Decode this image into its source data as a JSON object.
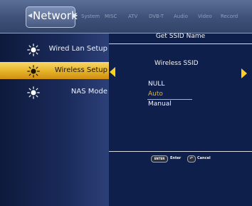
{
  "tabs": {
    "active": "Network",
    "items": [
      "System",
      "MISC",
      "ATV",
      "DVB-T",
      "Audio",
      "Video",
      "Record"
    ]
  },
  "sidebar": {
    "items": [
      {
        "label": "Wired Lan Setup",
        "icon": "sun-icon",
        "selected": false
      },
      {
        "label": "Wireless Setup",
        "icon": "sun-icon",
        "selected": true
      },
      {
        "label": "NAS Mode",
        "icon": "sun-icon",
        "selected": false
      }
    ]
  },
  "panel": {
    "title": "Get SSID Name",
    "subtitle": "Wireless SSID",
    "options": [
      "NULL",
      "Auto",
      "Manual"
    ],
    "selected_option": "Auto"
  },
  "hints": {
    "enter_key": "ENTER",
    "enter_label": "Enter",
    "cancel_icon": "back-arrow-icon",
    "cancel_label": "Cancel"
  },
  "colors": {
    "highlight": "#e7b52a",
    "arrow": "#ffd21f",
    "background": "#0f1d44"
  }
}
